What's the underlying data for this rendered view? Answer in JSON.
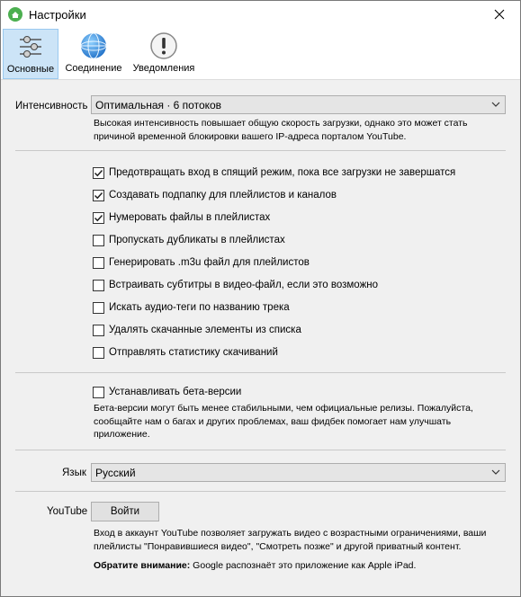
{
  "window": {
    "title": "Настройки"
  },
  "toolbar": {
    "tabs": [
      {
        "label": "Основные",
        "icon": "sliders-icon"
      },
      {
        "label": "Соединение",
        "icon": "globe-icon"
      },
      {
        "label": "Уведомления",
        "icon": "exclamation-icon"
      }
    ]
  },
  "intensity": {
    "label": "Интенсивность",
    "value": "Оптимальная · 6 потоков",
    "description_line1": "Высокая интенсивность повышает общую скорость загрузки, однако это может стать",
    "description_line2": "причиной временной блокировки вашего IP-адреса порталом YouTube."
  },
  "options": [
    {
      "label": "Предотвращать вход в спящий режим, пока все загрузки не завершатся",
      "checked": true
    },
    {
      "label": "Создавать подпапку для плейлистов и каналов",
      "checked": true
    },
    {
      "label": "Нумеровать файлы в плейлистах",
      "checked": true
    },
    {
      "label": "Пропускать дубликаты в плейлистах",
      "checked": false
    },
    {
      "label": "Генерировать .m3u файл для плейлистов",
      "checked": false
    },
    {
      "label": "Встраивать субтитры в видео-файл, если это возможно",
      "checked": false
    },
    {
      "label": "Искать аудио-теги по названию трека",
      "checked": false
    },
    {
      "label": "Удалять скачанные элементы из списка",
      "checked": false
    },
    {
      "label": "Отправлять статистику скачиваний",
      "checked": false
    }
  ],
  "beta": {
    "label": "Устанавливать бета-версии",
    "checked": false,
    "description_line1": "Бета-версии могут быть менее стабильными, чем официальные релизы.  Пожалуйста,",
    "description_line2": "сообщайте нам о багах и других проблемах, ваш фидбек помогает нам улучшать",
    "description_line3": "приложение."
  },
  "language": {
    "label": "Язык",
    "value": "Русский"
  },
  "youtube": {
    "label": "YouTube",
    "login_button": "Войти",
    "description_line1": "Вход в аккаунт YouTube позволяет загружать видео с возрастными ограничениями, ваши",
    "description_line2": "плейлисты \"Понравившиеся видео\", \"Смотреть позже\" и другой приватный контент.",
    "note_label": "Обратите внимание:",
    "note_text": " Google распознаёт это приложение как Apple iPad."
  },
  "colors": {
    "active_tab_bg": "#cce4f7",
    "app_icon": "#4caf50",
    "checkbox_border": "#333333"
  }
}
